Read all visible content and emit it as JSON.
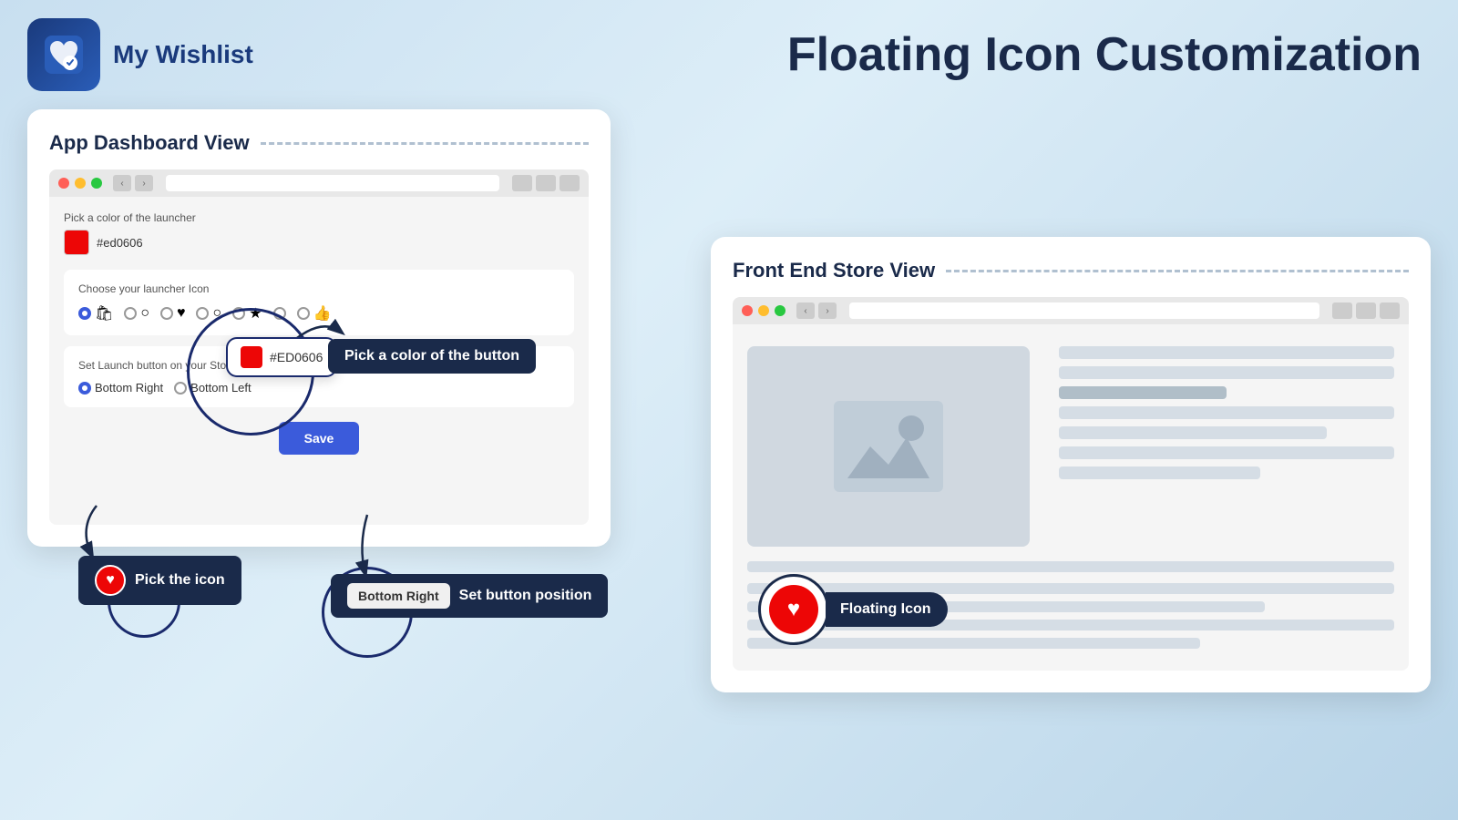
{
  "app": {
    "logo_alt": "My Wishlist logo",
    "title": "My Wishlist",
    "page_title": "Floating Icon Customization"
  },
  "dashboard": {
    "title": "App Dashboard View",
    "color_label": "Pick a color of the launcher",
    "color_value": "#ed0606",
    "color_hex_display": "#ED0606",
    "color_hex_text": "#ed0606",
    "icon_section_label": "Choose your launcher Icon",
    "position_section_label": "Set Launch button on your Storefront",
    "position_options": [
      "Bottom Right",
      "Bottom Left"
    ],
    "selected_position": "Bottom Right",
    "save_label": "Save",
    "annotation_color_label": "Pick a color of the button",
    "annotation_icon_label": "Pick the icon",
    "annotation_position_label": "Set button position"
  },
  "frontend": {
    "title": "Front End Store View",
    "floating_icon_label": "Floating Icon"
  },
  "icons": {
    "heart": "♥",
    "circle": "○",
    "star": "★",
    "thumb": "👍",
    "bag": "🛍"
  }
}
